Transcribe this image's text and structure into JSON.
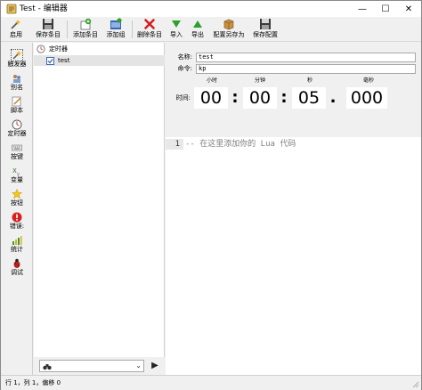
{
  "window": {
    "title": "Test - 编辑器"
  },
  "title_buttons": {
    "minimize": "—",
    "maximize": "☐",
    "close": "✕"
  },
  "toolbar": {
    "items": [
      {
        "label": "启用",
        "icon": "enable-icon"
      },
      {
        "label": "保存条目",
        "icon": "save-entry-icon"
      },
      {
        "label": "添加条目",
        "icon": "add-entry-icon"
      },
      {
        "label": "添加组",
        "icon": "add-group-icon"
      },
      {
        "label": "删除条目",
        "icon": "delete-icon"
      },
      {
        "label": "导入",
        "icon": "import-icon"
      },
      {
        "label": "导出",
        "icon": "export-icon"
      },
      {
        "label": "配置另存为",
        "icon": "config-save-as-icon"
      },
      {
        "label": "保存配置",
        "icon": "save-config-icon"
      }
    ]
  },
  "sidebar": {
    "items": [
      {
        "label": "触发器",
        "icon": "trigger-icon"
      },
      {
        "label": "别名",
        "icon": "alias-icon"
      },
      {
        "label": "脚本",
        "icon": "script-icon"
      },
      {
        "label": "定时器",
        "icon": "timer-icon"
      },
      {
        "label": "按键",
        "icon": "keys-icon"
      },
      {
        "label": "变量",
        "icon": "variable-icon"
      },
      {
        "label": "按钮",
        "icon": "button-star-icon"
      },
      {
        "label": "错误:",
        "icon": "error-icon"
      },
      {
        "label": "统计",
        "icon": "stats-icon"
      },
      {
        "label": "调试",
        "icon": "debug-icon"
      }
    ]
  },
  "tree": {
    "root": {
      "label": "定时器"
    },
    "child": {
      "label": "test",
      "checked": true
    }
  },
  "detail": {
    "name_label": "名称:",
    "name_value": "test",
    "command_label": "命令:",
    "command_value": "kp",
    "time_label": "时间:",
    "headers": {
      "hours": "小时",
      "minutes": "分钟",
      "seconds": "秒",
      "ms": "毫秒"
    },
    "values": {
      "hours": "00",
      "minutes": "00",
      "seconds": "05",
      "ms": "000"
    },
    "sep_colon": ":",
    "sep_dot": "."
  },
  "editor": {
    "line_number": "1",
    "code": "-- 在这里添加你的 Lua 代码"
  },
  "status": {
    "text": "行 1，列 1，偏移 0"
  },
  "colors": {
    "accent": "#2a5db0",
    "selected_row": "#e4e4e4",
    "editor_gutter": "#e8e8e8",
    "comment": "#808080"
  }
}
